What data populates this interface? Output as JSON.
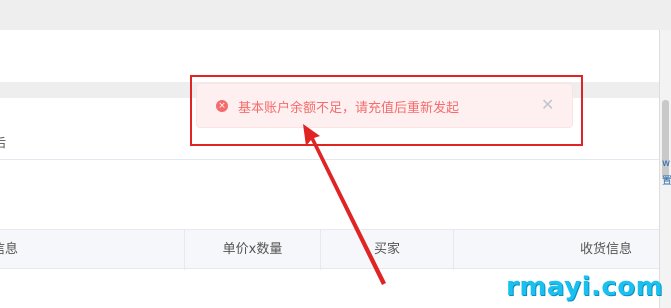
{
  "toast": {
    "type": "error",
    "message": "基本账户余额不足，请充值后重新发起",
    "icon": "error-circle-icon",
    "close_icon": "close-icon",
    "close_glyph": "✕",
    "icon_glyph": "×"
  },
  "partial_row": {
    "text": "后"
  },
  "table": {
    "headers": [
      "信息",
      "单价x数量",
      "买家",
      "收货信息"
    ]
  },
  "edge_text": {
    "line1": "w",
    "line2": "置"
  },
  "watermark": {
    "text": "rmayi.com"
  },
  "colors": {
    "error": "#f56c6c",
    "annotation": "#e02424",
    "watermark": "#1ac1f0"
  }
}
